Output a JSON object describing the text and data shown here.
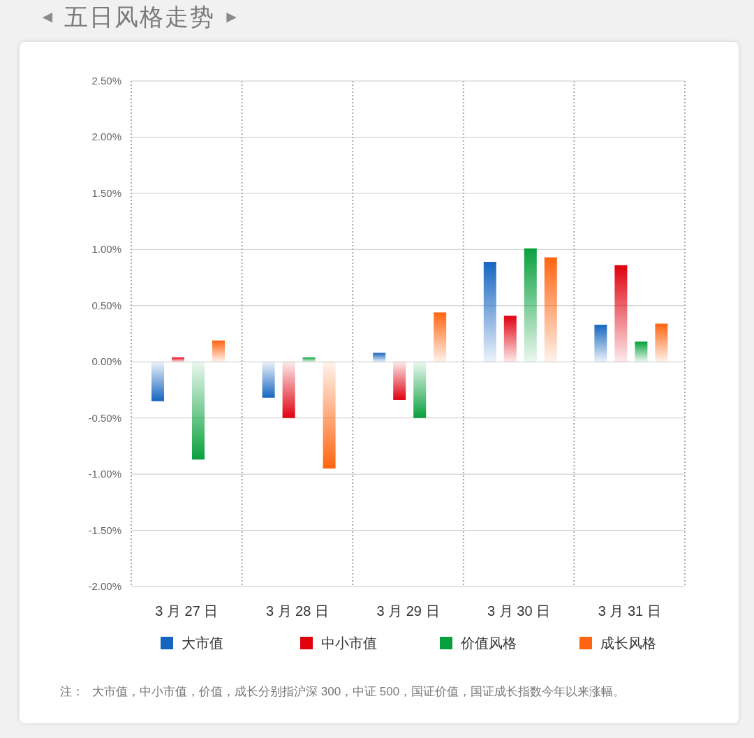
{
  "header": {
    "prev_arrow": "◄",
    "title": "五日风格走势",
    "next_arrow": "►"
  },
  "chart_data": {
    "type": "bar",
    "categories": [
      "3 月 27 日",
      "3 月 28 日",
      "3 月 29 日",
      "3 月 30 日",
      "3 月 31 日"
    ],
    "series": [
      {
        "name": "大市值",
        "color": "#1565c0",
        "values": [
          -0.35,
          -0.32,
          0.08,
          0.89,
          0.33
        ]
      },
      {
        "name": "中小市值",
        "color": "#e0000e",
        "values": [
          0.04,
          -0.5,
          -0.34,
          0.41,
          0.86
        ]
      },
      {
        "name": "价值风格",
        "color": "#08a03c",
        "values": [
          -0.87,
          0.04,
          -0.5,
          1.01,
          0.18
        ]
      },
      {
        "name": "成长风格",
        "color": "#ff6410",
        "values": [
          0.19,
          -0.95,
          0.44,
          0.93,
          0.34
        ]
      }
    ],
    "ylim": [
      -2,
      2.5
    ],
    "grid": true,
    "yticks": [
      {
        "value": 2.5,
        "label": "2.50%"
      },
      {
        "value": 2,
        "label": "2.00%"
      },
      {
        "value": 1.5,
        "label": "1.50%"
      },
      {
        "value": 1,
        "label": "1.00%"
      },
      {
        "value": 0.5,
        "label": "0.50%"
      },
      {
        "value": 0,
        "label": "0.00%"
      },
      {
        "value": -0.5,
        "label": "-0.50%"
      },
      {
        "value": -1,
        "label": "-1.00%"
      },
      {
        "value": -1.5,
        "label": "-1.50%"
      },
      {
        "value": -2,
        "label": "-2.00%"
      }
    ]
  },
  "note": {
    "label": "注：",
    "text": "大市值，中小市值，价值，成长分别指沪深 300，中证 500，国证价值，国证成长指数今年以来涨幅。"
  }
}
